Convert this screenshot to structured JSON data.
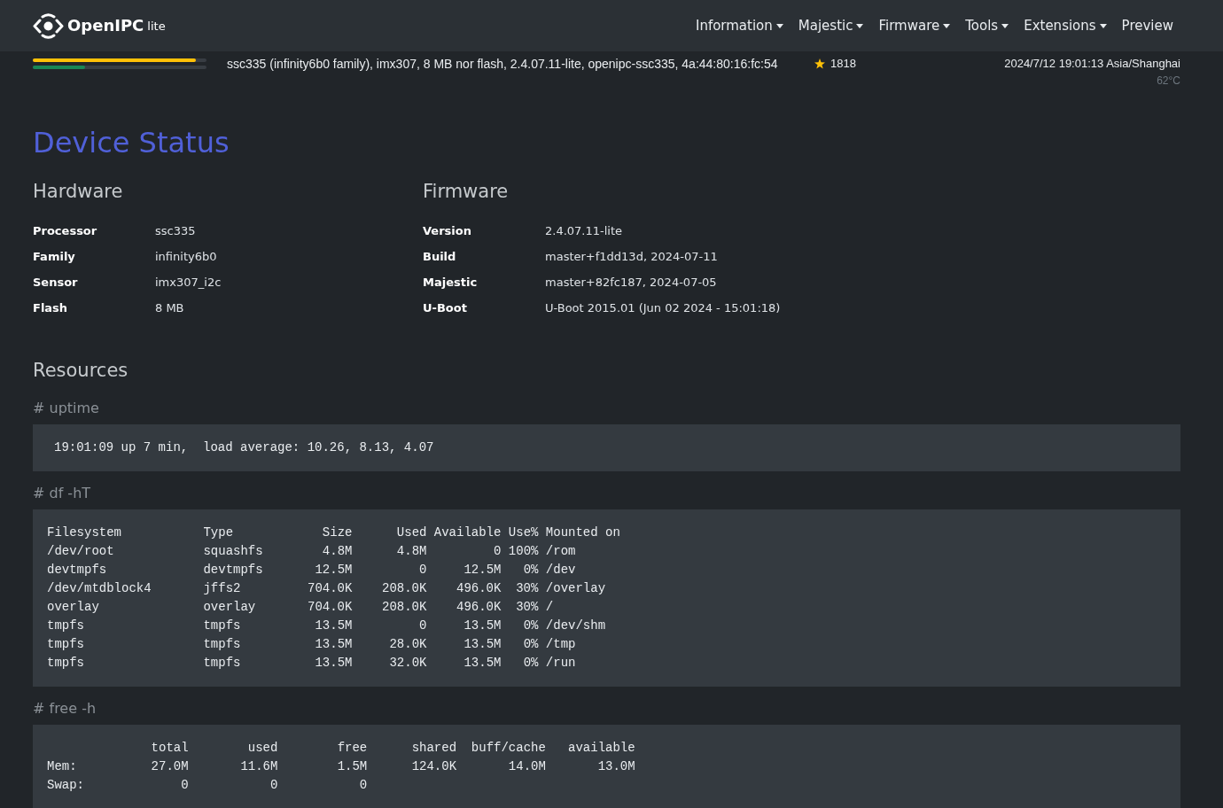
{
  "navbar": {
    "brand": "OpenIPC",
    "brand_suffix": "lite",
    "menu": [
      {
        "label": "Information",
        "dropdown": true
      },
      {
        "label": "Majestic",
        "dropdown": true
      },
      {
        "label": "Firmware",
        "dropdown": true
      },
      {
        "label": "Tools",
        "dropdown": true
      },
      {
        "label": "Extensions",
        "dropdown": true
      },
      {
        "label": "Preview",
        "dropdown": false
      }
    ]
  },
  "info_bar": {
    "meters": [
      {
        "level": 0.94,
        "color": "#ffc107"
      },
      {
        "level": 0.3,
        "color": "#198754"
      }
    ],
    "summary": "ssc335 (infinity6b0 family), imx307, 8 MB nor flash, 2.4.07.11-lite, openipc-ssc335, 4a:44:80:16:fc:54",
    "star_badge": "1818",
    "datetime": "2024/7/12 19:01:13 Asia/Shanghai",
    "temperature": "62°C"
  },
  "page_title": "Device Status",
  "sections": [
    {
      "title": "Hardware",
      "rows": [
        {
          "label": "Processor",
          "value": "ssc335"
        },
        {
          "label": "Family",
          "value": "infinity6b0"
        },
        {
          "label": "Sensor",
          "value": "imx307_i2c"
        },
        {
          "label": "Flash",
          "value": "8 MB"
        }
      ]
    },
    {
      "title": "Firmware",
      "rows": [
        {
          "label": "Version",
          "value": "2.4.07.11-lite"
        },
        {
          "label": "Build",
          "value": "master+f1dd13d, 2024-07-11"
        },
        {
          "label": "Majestic",
          "value": "master+82fc187, 2024-07-05"
        },
        {
          "label": "U-Boot",
          "value": "U-Boot 2015.01 (Jun 02 2024 - 15:01:18)"
        }
      ]
    }
  ],
  "resources": {
    "title": "Resources",
    "blocks": [
      {
        "kind": "text",
        "command": "# uptime",
        "lines": [
          "19:01:09 up 7 min,  load average: 10.26, 8.13, 4.07"
        ]
      },
      {
        "kind": "disks",
        "command": "# df -hT",
        "columns": [
          "Filesystem",
          "Type",
          "Size",
          "Used",
          "Available",
          "Use%",
          "Mounted on"
        ],
        "rows": [
          [
            "/dev/root",
            "squashfs",
            "4.8M",
            "4.8M",
            "0",
            "100%",
            "/rom"
          ],
          [
            "devtmpfs",
            "devtmpfs",
            "12.5M",
            "0",
            "12.5M",
            "0%",
            "/dev"
          ],
          [
            "/dev/mtdblock4",
            "jffs2",
            "704.0K",
            "208.0K",
            "496.0K",
            "30%",
            "/overlay"
          ],
          [
            "overlay",
            "overlay",
            "704.0K",
            "208.0K",
            "496.0K",
            "30%",
            "/"
          ],
          [
            "tmpfs",
            "tmpfs",
            "13.5M",
            "0",
            "13.5M",
            "0%",
            "/dev/shm"
          ],
          [
            "tmpfs",
            "tmpfs",
            "13.5M",
            "28.0K",
            "13.5M",
            "0%",
            "/tmp"
          ],
          [
            "tmpfs",
            "tmpfs",
            "13.5M",
            "32.0K",
            "13.5M",
            "0%",
            "/run"
          ]
        ]
      },
      {
        "kind": "memory",
        "command": "# free -h",
        "columns": [
          "",
          "total",
          "used",
          "free",
          "shared",
          "buff/cache",
          "available"
        ],
        "rows": [
          [
            "Mem:",
            "27.0M",
            "11.6M",
            "1.5M",
            "124.0K",
            "14.0M",
            "13.0M"
          ],
          [
            "Swap:",
            "0",
            "0",
            "0"
          ]
        ]
      }
    ]
  }
}
